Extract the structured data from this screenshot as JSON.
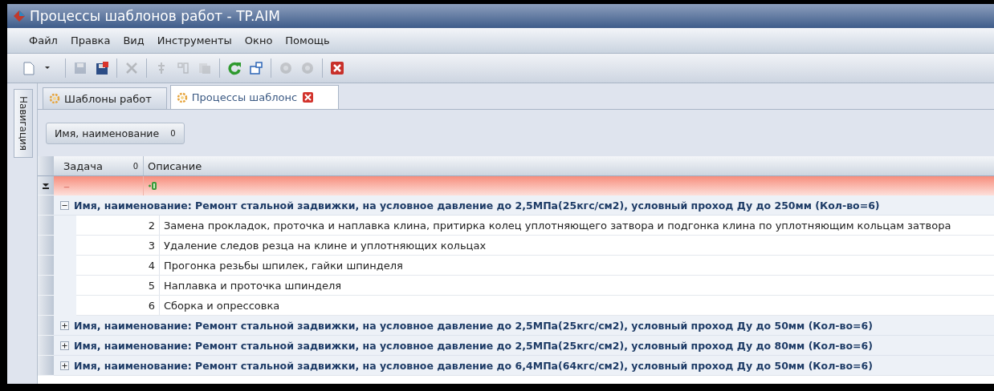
{
  "window": {
    "title": "Процессы шаблонов работ - TP.AIM"
  },
  "menu": [
    "Файл",
    "Правка",
    "Вид",
    "Инструменты",
    "Окно",
    "Помощь"
  ],
  "toolbar": [
    {
      "kind": "new",
      "disabled": false
    },
    {
      "kind": "dropdown",
      "disabled": false
    },
    {
      "kind": "separator"
    },
    {
      "kind": "save",
      "disabled": true
    },
    {
      "kind": "save-close",
      "disabled": false
    },
    {
      "kind": "separator"
    },
    {
      "kind": "delete",
      "disabled": true
    },
    {
      "kind": "separator"
    },
    {
      "kind": "move",
      "disabled": true
    },
    {
      "kind": "edit",
      "disabled": true
    },
    {
      "kind": "copy",
      "disabled": true
    },
    {
      "kind": "separator"
    },
    {
      "kind": "refresh",
      "disabled": false
    },
    {
      "kind": "window",
      "disabled": false
    },
    {
      "kind": "separator"
    },
    {
      "kind": "circle",
      "disabled": true
    },
    {
      "kind": "circle",
      "disabled": true
    },
    {
      "kind": "separator"
    },
    {
      "kind": "close",
      "disabled": false
    }
  ],
  "sidebar": {
    "label": "Навигация"
  },
  "tabs": [
    {
      "label": "Шаблоны работ",
      "selected": false,
      "closable": false
    },
    {
      "label": "Процессы шаблонс",
      "selected": true,
      "closable": true
    }
  ],
  "group_panel": {
    "label": "Имя, наименование",
    "sort": "0"
  },
  "table": {
    "columns": [
      {
        "label": "Задача",
        "sort": "0"
      },
      {
        "label": "Описание"
      }
    ],
    "filter_row": {
      "task": "–"
    },
    "groups": [
      {
        "label": "Имя, наименование: Ремонт стальной задвижки, на условное давление до 2,5МПа(25кгс/см2), условный проход Ду до 250мм (Кол-во=6)",
        "expanded": true,
        "children": [
          {
            "task": "2",
            "description": "Замена прокладок, проточка и наплавка клина, притирка колец уплотняющего затвора и подгонка клина по уплотняющим кольцам затвора"
          },
          {
            "task": "3",
            "description": "Удаление следов резца на клине и уплотняющих кольцах"
          },
          {
            "task": "4",
            "description": "Прогонка резьбы шпилек, гайки шпинделя"
          },
          {
            "task": "5",
            "description": "Наплавка и проточка шпинделя"
          },
          {
            "task": "6",
            "description": "Сборка и опрессовка"
          }
        ]
      },
      {
        "label": "Имя, наименование: Ремонт стальной задвижки, на условное давление до 2,5МПа(25кгс/см2), условный проход Ду до 50мм (Кол-во=6)",
        "expanded": false
      },
      {
        "label": "Имя, наименование: Ремонт стальной задвижки, на условное давление до 2,5МПа(25кгс/см2), условный проход Ду до 80мм (Кол-во=6)",
        "expanded": false
      },
      {
        "label": "Имя, наименование: Ремонт стальной задвижки, на условное давление до 6,4МПа(64кгс/см2), условный проход Ду до 50мм (Кол-во=6)",
        "expanded": false
      }
    ]
  }
}
